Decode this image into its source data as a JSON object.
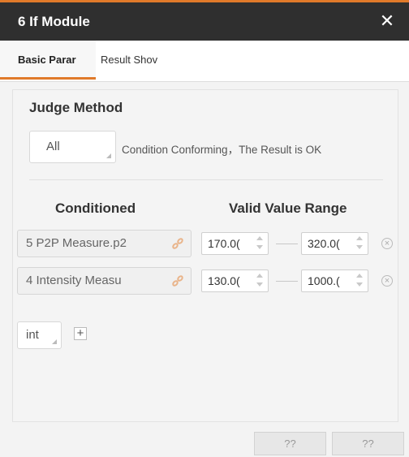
{
  "window": {
    "title": "6 If Module"
  },
  "tabs": [
    {
      "label": "Basic Parar"
    },
    {
      "label": "Result Shov"
    }
  ],
  "judge": {
    "label": "Judge Method",
    "selected": "All",
    "description": "Condition Conforming，The Result is OK"
  },
  "columns": {
    "conditioned": "Conditioned",
    "range": "Valid Value Range"
  },
  "conditions": [
    {
      "name": "5 P2P Measure.p2",
      "min": "170.0(",
      "max": "320.0("
    },
    {
      "name": "4 Intensity Measu",
      "min": "130.0(",
      "max": "1000.("
    }
  ],
  "add_type": {
    "selected": "int"
  },
  "footer": {
    "button1": "??",
    "button2": "??"
  },
  "colors": {
    "accent": "#e07a2a",
    "titlebar": "#2f2f2f"
  },
  "icons": {
    "close": "close-icon",
    "link": "link-icon",
    "remove": "remove-icon",
    "add": "plus-icon"
  }
}
